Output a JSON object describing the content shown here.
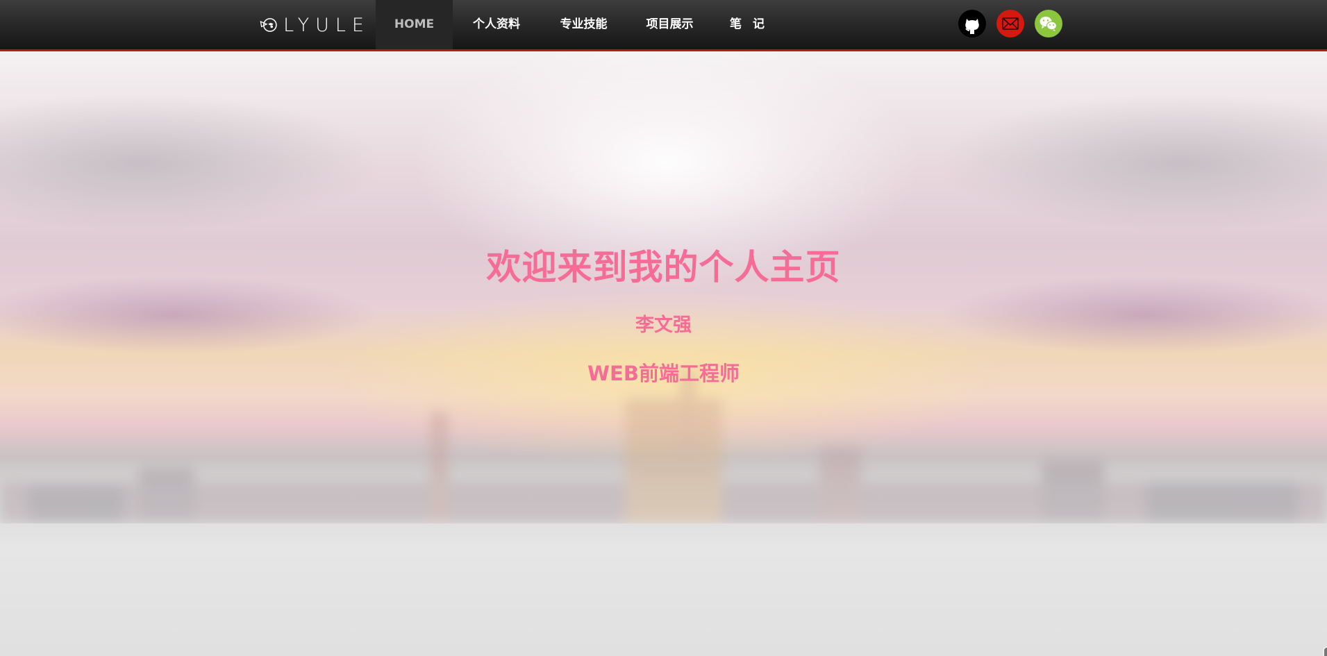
{
  "header": {
    "logo_text": "LYULE",
    "nav": [
      {
        "label": "HOME",
        "active": true
      },
      {
        "label": "个人资料",
        "active": false
      },
      {
        "label": "专业技能",
        "active": false
      },
      {
        "label": "项目展示",
        "active": false
      },
      {
        "label": "笔 记",
        "active": false
      }
    ],
    "social": [
      {
        "icon": "github-icon",
        "color": "#000000"
      },
      {
        "icon": "mail-icon",
        "color": "#d4190f"
      },
      {
        "icon": "wechat-icon",
        "color": "#8cc63f"
      }
    ],
    "accent_border": "#b31b1b"
  },
  "hero": {
    "title": "欢迎来到我的个人主页",
    "name": "李文强",
    "role": "WEB前端工程师",
    "text_color": "#f76b97"
  }
}
